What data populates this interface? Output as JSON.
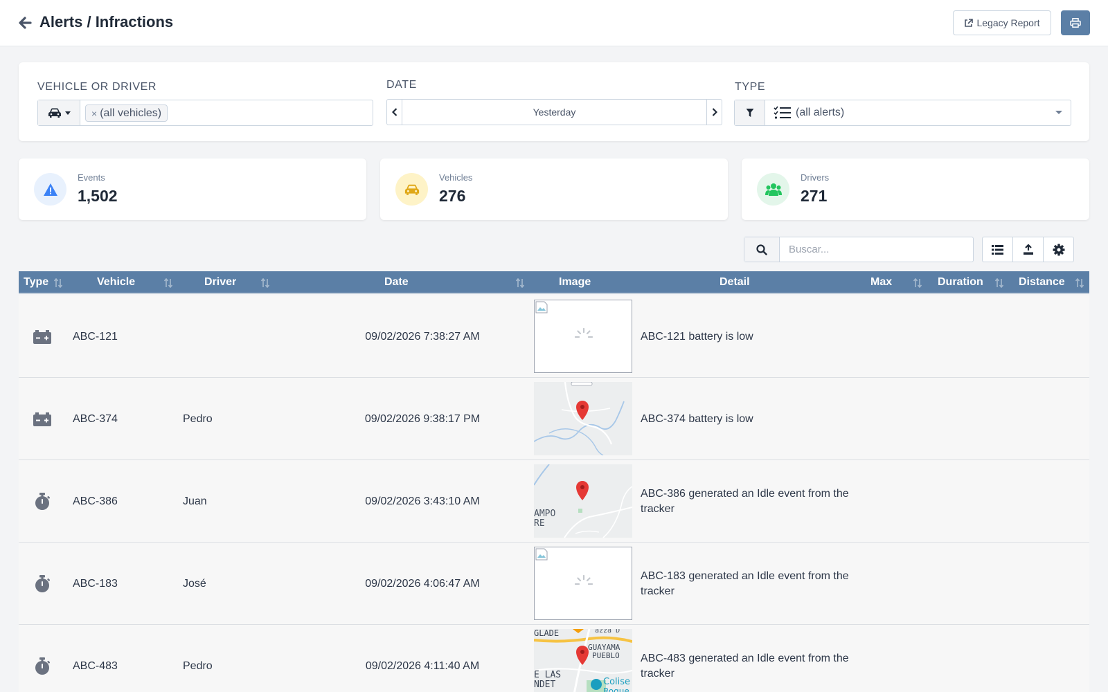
{
  "header": {
    "title": "Alerts / Infractions",
    "legacy_label": "Legacy Report"
  },
  "filters": {
    "vehicle_label": "VEHICLE OR DRIVER",
    "vehicle_tag": "(all vehicles)",
    "vehicle_tag_remove": "×",
    "date_label": "DATE",
    "date_value": "Yesterday",
    "type_label": "TYPE",
    "type_value": "(all alerts)"
  },
  "stats": [
    {
      "label": "Events",
      "value": "1,502",
      "icon": "warning-icon",
      "bg": "#e8f1fd",
      "color": "#3b82f6"
    },
    {
      "label": "Vehicles",
      "value": "276",
      "icon": "car-icon",
      "bg": "#fef3c7",
      "color": "#e0a818"
    },
    {
      "label": "Drivers",
      "value": "271",
      "icon": "users-icon",
      "bg": "#e3f6ea",
      "color": "#22c55e"
    }
  ],
  "search": {
    "placeholder": "Buscar..."
  },
  "table": {
    "columns": [
      "Type",
      "Vehicle",
      "Driver",
      "Date",
      "Image",
      "Detail",
      "Max",
      "Duration",
      "Distance"
    ],
    "rows": [
      {
        "type_icon": "battery-icon",
        "vehicle": "ABC-121",
        "driver": "",
        "date": "09/02/2026 7:38:27 AM",
        "image": "loading",
        "detail": "ABC-121 battery is low"
      },
      {
        "type_icon": "battery-icon",
        "vehicle": "ABC-374",
        "driver": "Pedro",
        "date": "09/02/2026 9:38:17 PM",
        "image": "map",
        "detail": "ABC-374 battery is low"
      },
      {
        "type_icon": "stopwatch-icon",
        "vehicle": "ABC-386",
        "driver": "Juan",
        "date": "09/02/2026 3:43:10 AM",
        "image": "map",
        "detail": "ABC-386 generated an Idle event from the tracker",
        "map_labels": [
          "AMPO",
          "RE"
        ]
      },
      {
        "type_icon": "stopwatch-icon",
        "vehicle": "ABC-183",
        "driver": "José",
        "date": "09/02/2026 4:06:47 AM",
        "image": "loading",
        "detail": "ABC-183 generated an Idle event from the tracker"
      },
      {
        "type_icon": "stopwatch-icon",
        "vehicle": "ABC-483",
        "driver": "Pedro",
        "date": "09/02/2026 4:11:40 AM",
        "image": "map",
        "detail": "ABC-483 generated an Idle event from the tracker",
        "map_labels": [
          "GLADE",
          "GUAYAMA",
          "PUEBLO",
          "E LAS",
          "NDET",
          "Colise",
          "Roque"
        ]
      }
    ]
  },
  "colors": {
    "accent": "#5b7fa6",
    "marker": "#e53935",
    "icon_gray": "#6b7280"
  }
}
